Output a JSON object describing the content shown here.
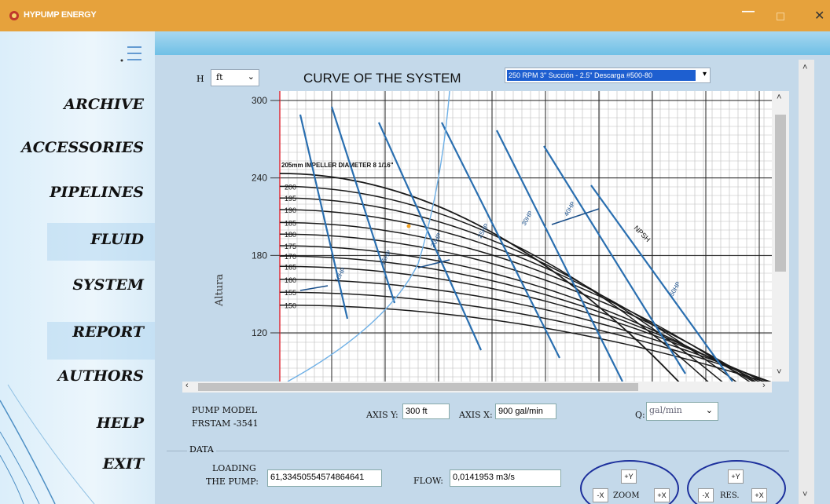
{
  "window": {
    "title": "HYPUMP ENERGY",
    "minimize": "—",
    "maximize": "",
    "close": "✕"
  },
  "sidebar": {
    "items": [
      {
        "label": "ARCHIVE"
      },
      {
        "label": "ACCESSORIES"
      },
      {
        "label": "PIPELINES"
      },
      {
        "label": "FLUID"
      },
      {
        "label": "SYSTEM"
      },
      {
        "label": "REPORT"
      },
      {
        "label": "AUTHORS"
      },
      {
        "label": "HELP"
      },
      {
        "label": "EXIT"
      }
    ]
  },
  "chart_header": {
    "h_label": "H",
    "unit": "ft",
    "title": "CURVE OF THE SYSTEM",
    "pump_selection": "250 RPM 3\" Succión - 2.5\" Descarga #500-80"
  },
  "chart_data": {
    "type": "line",
    "ylabel": "Altura",
    "yticks": [
      "300",
      "240",
      "180",
      "120"
    ],
    "ylim": [
      90,
      300
    ],
    "impeller_label": "205mm IMPELLER DIAMETER 8 1/16\"",
    "impeller_diameters": [
      "200",
      "195",
      "190",
      "185",
      "180",
      "175",
      "170",
      "165",
      "160",
      "155",
      "150"
    ],
    "power_labels": [
      "10HP",
      "15HP",
      "20HP",
      "25HP",
      "30HP",
      "40HP",
      "50HP"
    ],
    "npsh_label": "NPSH",
    "grid": true
  },
  "bottom": {
    "pump_model_label": "PUMP MODEL",
    "pump_model_value": "FRSTAM -3541",
    "axis_y_label": "AXIS Y:",
    "axis_y_value": "300 ft",
    "axis_x_label": "AXIS X:",
    "axis_x_value": "900 gal/min",
    "q_label": "Q:",
    "q_unit": "gal/min"
  },
  "data_section": {
    "title": "DATA",
    "loading_label_1": "LOADING",
    "loading_label_2": "THE PUMP:",
    "loading_value": "61,33450554574864641",
    "flow_label": "FLOW:",
    "flow_value": "0,0141953 m3/s",
    "zoom": {
      "plus_y": "+Y",
      "minus_x": "-X",
      "label": "ZOOM",
      "plus_x": "+X"
    },
    "res": {
      "plus_y": "+Y",
      "minus_x": "-X",
      "label": "RES.",
      "plus_x": "+X"
    }
  },
  "colors": {
    "titlebar": "#e6a23c",
    "panel": "#c4d9ea",
    "curve_blue": "#2a6fb0",
    "ring_blue": "#1c2f9c"
  }
}
